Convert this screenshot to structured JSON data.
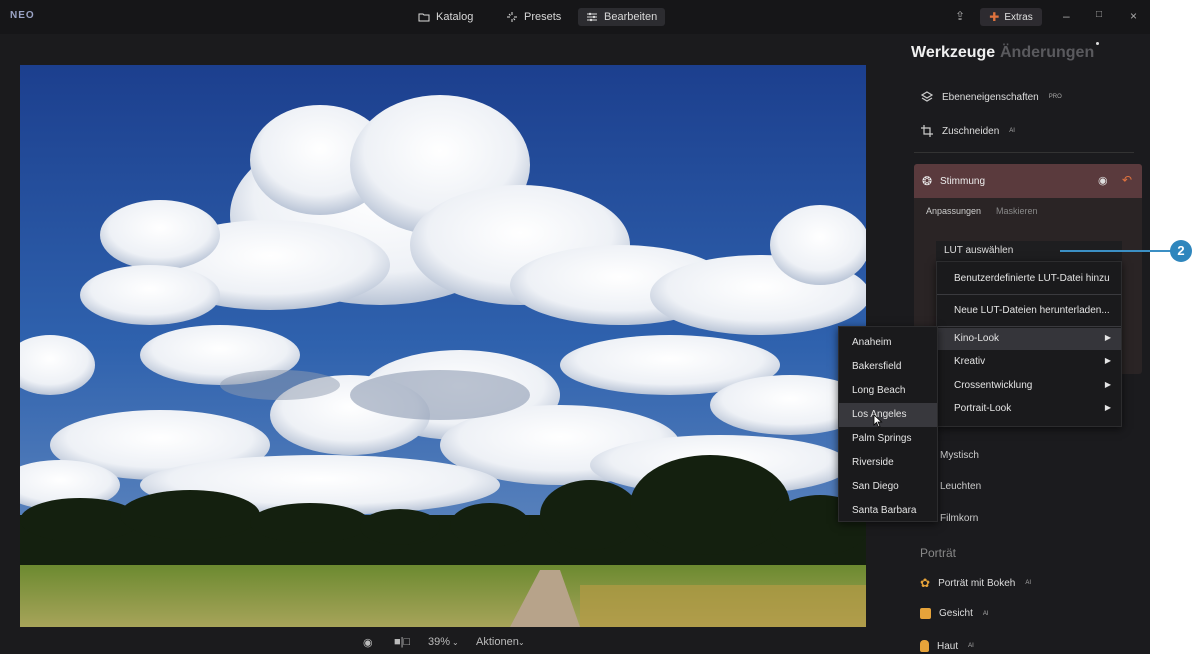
{
  "app": {
    "logo": "NEO"
  },
  "topbar": {
    "tabs": [
      {
        "label": "Katalog",
        "icon": "folder-icon"
      },
      {
        "label": "Presets",
        "icon": "sparkle-icon"
      },
      {
        "label": "Bearbeiten",
        "icon": "sliders-icon"
      }
    ],
    "extras_label": "Extras"
  },
  "bottombar": {
    "zoom": "39%",
    "actions_label": "Aktionen"
  },
  "panel": {
    "title": "Werkzeuge",
    "title_inactive": "Änderungen",
    "tools": [
      {
        "label": "Ebeneneigenschaften",
        "badge": "PRO"
      },
      {
        "label": "Zuschneiden",
        "badge": "AI"
      }
    ],
    "stimmung": {
      "label": "Stimmung",
      "subtab_active": "Anpassungen",
      "subtab_inactive": "Maskieren",
      "lut_button": "LUT auswählen"
    },
    "lower_items": [
      {
        "label": "Mystisch"
      },
      {
        "label": "Leuchten"
      },
      {
        "label": "Filmkorn"
      }
    ],
    "section_portrait": "Porträt",
    "portrait_items": [
      {
        "label": "Porträt mit Bokeh",
        "badge": "AI"
      },
      {
        "label": "Gesicht",
        "badge": "AI"
      },
      {
        "label": "Haut",
        "badge": "AI"
      }
    ]
  },
  "lut_menu": {
    "items": [
      {
        "label": "Benutzerdefinierte LUT-Datei hinzu"
      },
      {
        "label": "Neue LUT-Dateien herunterladen..."
      },
      {
        "label": "Kino-Look"
      },
      {
        "label": "Kreativ"
      },
      {
        "label": "Crossentwicklung"
      },
      {
        "label": "Portrait-Look"
      }
    ]
  },
  "kino_submenu": {
    "items": [
      "Anaheim",
      "Bakersfield",
      "Long Beach",
      "Los Angeles",
      "Palm Springs",
      "Riverside",
      "San Diego",
      "Santa Barbara"
    ],
    "highlighted": "Los Angeles"
  },
  "callout": {
    "number": "2",
    "color": "#2f86bd"
  },
  "colors": {
    "accent": "#d9603a",
    "stimmung_header": "#5a3a3d",
    "background": "#1b1b1d"
  }
}
